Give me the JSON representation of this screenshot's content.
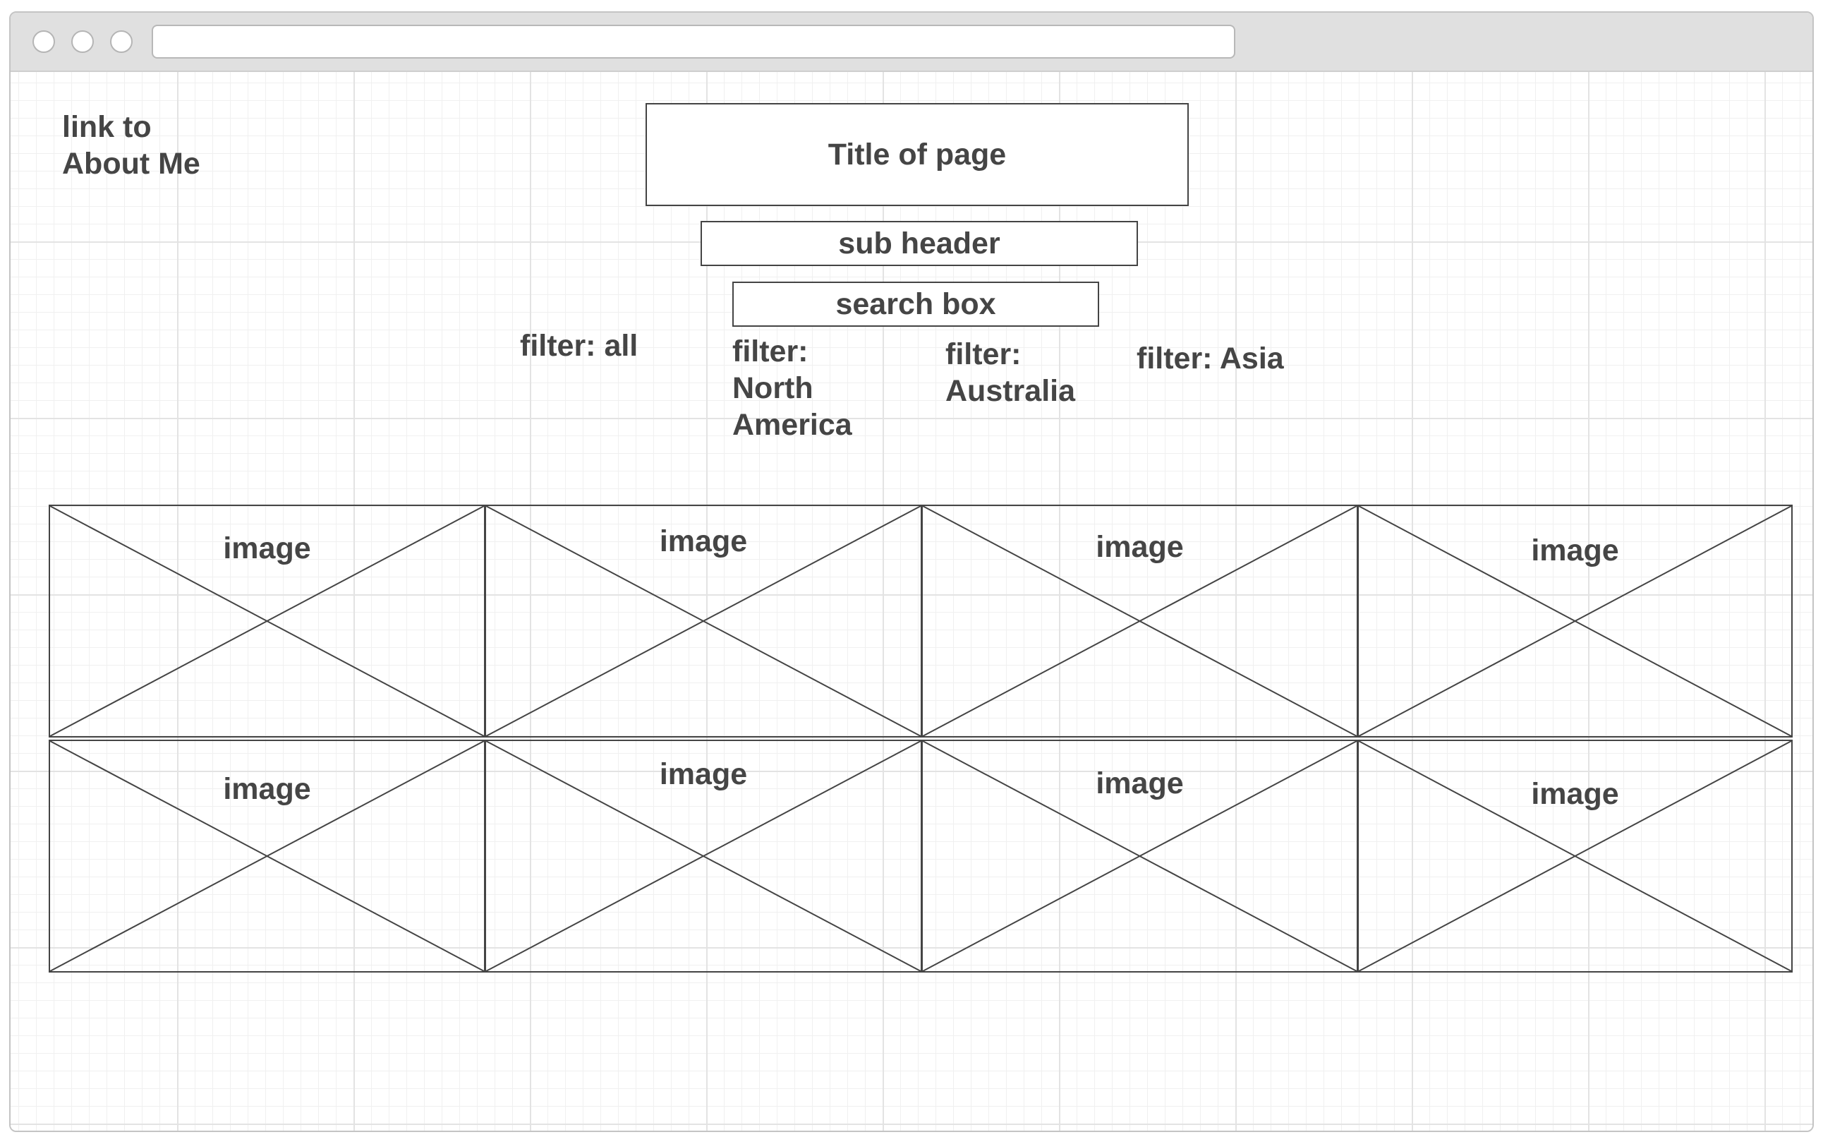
{
  "nav": {
    "about_link": "link to\nAbout Me"
  },
  "header": {
    "title": "Title of page",
    "subheader": "sub header",
    "search": "search box"
  },
  "filters": [
    {
      "label": "filter: all"
    },
    {
      "label": "filter:\nNorth\nAmerica"
    },
    {
      "label": "filter:\nAustralia"
    },
    {
      "label": "filter: Asia"
    }
  ],
  "gallery": {
    "rows": [
      [
        "image",
        "image",
        "image",
        "image"
      ],
      [
        "image",
        "image",
        "image",
        "image"
      ]
    ]
  },
  "colors": {
    "stroke": "#444444",
    "text": "#454545",
    "grid": "#e3e3e3",
    "chrome": "#e0e0e0"
  }
}
